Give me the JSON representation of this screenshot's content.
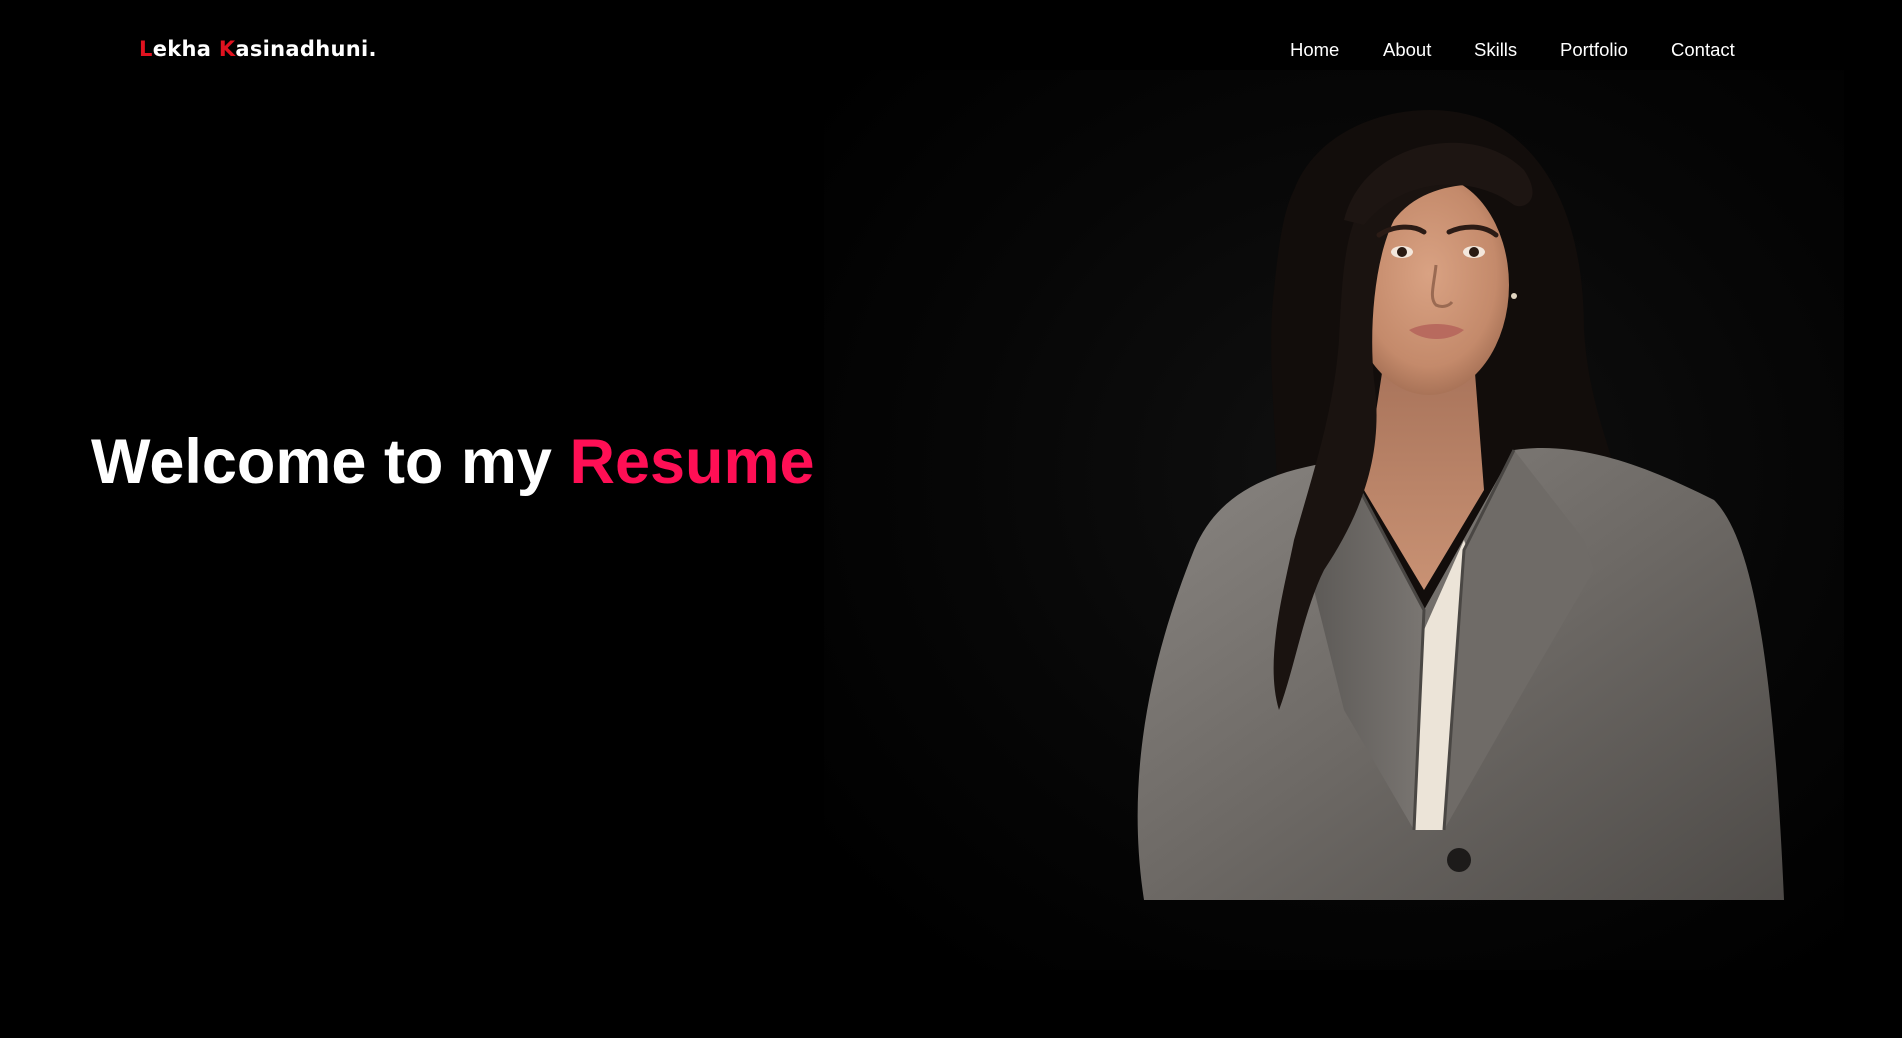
{
  "header": {
    "logo": {
      "first_initial": "L",
      "first_rest": "ekha ",
      "last_initial": "K",
      "last_rest": "asinadhuni."
    },
    "nav": [
      {
        "label": "Home"
      },
      {
        "label": "About"
      },
      {
        "label": "Skills"
      },
      {
        "label": "Portfolio"
      },
      {
        "label": "Contact"
      }
    ]
  },
  "hero": {
    "title_prefix": "Welcome to my ",
    "title_highlight": "Resume"
  },
  "colors": {
    "background": "#000000",
    "text": "#ffffff",
    "logo_accent": "#e1121f",
    "highlight": "#ff0f55"
  }
}
